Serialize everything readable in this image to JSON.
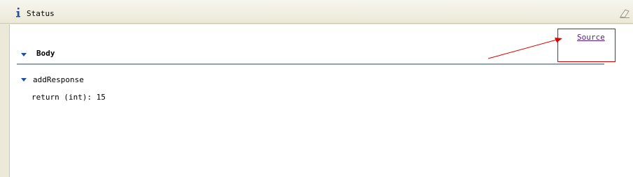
{
  "panel": {
    "title": "Status",
    "title_icon": "info-icon",
    "clear_icon": "eraser-icon"
  },
  "content": {
    "source_link": "Source",
    "body_section": {
      "label": "Body",
      "expanded": true
    },
    "response": {
      "label": "addResponse",
      "expanded": true,
      "return_line": "return (int): 15"
    }
  },
  "colors": {
    "background": "#ece9d8",
    "content_bg": "#ffffff",
    "link": "#551a8b",
    "rule": "#8fa3b8",
    "annotation": "#e00000",
    "toggle": "#1f4f9e"
  }
}
